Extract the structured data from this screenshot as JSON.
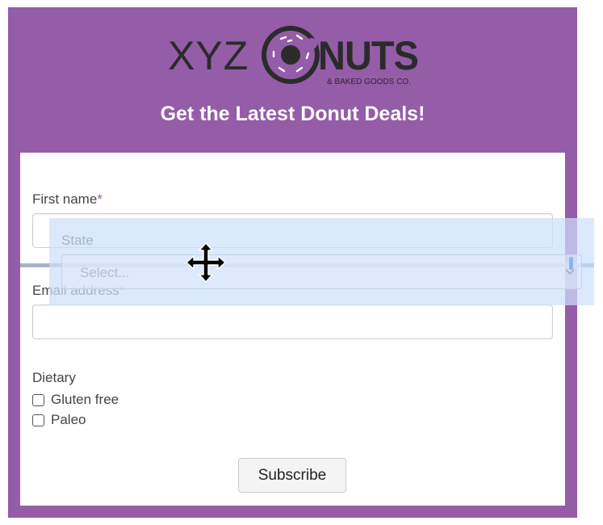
{
  "header": {
    "logo": {
      "prefix": "XYZ",
      "brand": "DONUTS",
      "tagline": "& BAKED GOODS CO."
    },
    "headline": "Get the Latest Donut Deals!"
  },
  "form": {
    "first_name": {
      "label": "First name",
      "required_mark": "*",
      "value": ""
    },
    "email": {
      "label": "Email address",
      "required_mark": "*",
      "value": ""
    },
    "dietary": {
      "label": "Dietary",
      "options": [
        {
          "label": "Gluten free",
          "checked": false
        },
        {
          "label": "Paleo",
          "checked": false
        }
      ]
    },
    "subscribe_label": "Subscribe"
  },
  "dragged_field": {
    "label": "State",
    "placeholder": "Select..."
  },
  "colors": {
    "brand_purple": "#955ca8",
    "drag_overlay": "#cde0fc"
  },
  "icons": [
    "move-cursor-icon",
    "chevron-down-icon",
    "checkbox-icon"
  ]
}
